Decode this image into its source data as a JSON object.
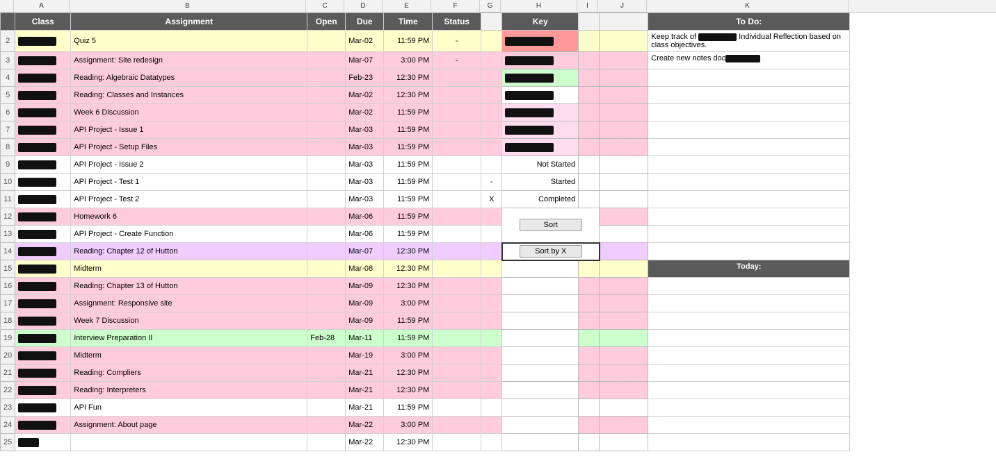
{
  "header": {
    "col_labels": [
      "",
      "A",
      "B",
      "C",
      "D",
      "E",
      "F",
      "G",
      "H",
      "I",
      "J",
      "K"
    ],
    "row1": {
      "class": "Class",
      "assignment": "Assignment",
      "open": "Open",
      "due": "Due",
      "time": "Time",
      "status": "Status",
      "key": "Key",
      "todo": "To Do:"
    }
  },
  "rows": [
    {
      "num": 2,
      "class": "",
      "assignment": "Quiz 5",
      "open": "",
      "due": "Mar-02",
      "time": "11:59 PM",
      "status": "-",
      "color": "yellow"
    },
    {
      "num": 3,
      "class": "",
      "assignment": "Assignment: Site redesign",
      "open": "",
      "due": "Mar-07",
      "time": "3:00 PM",
      "status": "-",
      "color": "pink"
    },
    {
      "num": 4,
      "class": "",
      "assignment": "Reading: Algebraic Datatypes",
      "open": "",
      "due": "Feb-23",
      "time": "12:30 PM",
      "status": "",
      "color": "pink"
    },
    {
      "num": 5,
      "class": "",
      "assignment": "Reading: Classes and Instances",
      "open": "",
      "due": "Mar-02",
      "time": "12:30 PM",
      "status": "",
      "color": "pink"
    },
    {
      "num": 6,
      "class": "",
      "assignment": "Week 6 Discussion",
      "open": "",
      "due": "Mar-02",
      "time": "11:59 PM",
      "status": "",
      "color": "pink"
    },
    {
      "num": 7,
      "class": "",
      "assignment": "API Project - Issue 1",
      "open": "",
      "due": "Mar-03",
      "time": "11:59 PM",
      "status": "",
      "color": "pink"
    },
    {
      "num": 8,
      "class": "",
      "assignment": "API Project - Setup Files",
      "open": "",
      "due": "Mar-03",
      "time": "11:59 PM",
      "status": "",
      "color": "pink"
    },
    {
      "num": 9,
      "class": "",
      "assignment": "API Project - Issue 2",
      "open": "",
      "due": "Mar-03",
      "time": "11:59 PM",
      "status": "",
      "color": "white"
    },
    {
      "num": 10,
      "class": "",
      "assignment": "API Project - Test 1",
      "open": "",
      "due": "Mar-03",
      "time": "11:59 PM",
      "status": "",
      "color": "white"
    },
    {
      "num": 11,
      "class": "",
      "assignment": "API Project - Test 2",
      "open": "",
      "due": "Mar-03",
      "time": "11:59 PM",
      "status": "",
      "color": "white"
    },
    {
      "num": 12,
      "class": "",
      "assignment": "Homework 6",
      "open": "",
      "due": "Mar-06",
      "time": "11:59 PM",
      "status": "",
      "color": "pink"
    },
    {
      "num": 13,
      "class": "",
      "assignment": "API Project - Create Function",
      "open": "",
      "due": "Mar-06",
      "time": "11:59 PM",
      "status": "",
      "color": "white"
    },
    {
      "num": 14,
      "class": "",
      "assignment": "Reading: Chapter 12 of Hutton",
      "open": "",
      "due": "Mar-07",
      "time": "12:30 PM",
      "status": "",
      "color": "lavender"
    },
    {
      "num": 15,
      "class": "",
      "assignment": "Midterm",
      "open": "",
      "due": "Mar-08",
      "time": "12:30 PM",
      "status": "",
      "color": "yellow"
    },
    {
      "num": 16,
      "class": "",
      "assignment": "Reading: Chapter 13 of Hutton",
      "open": "",
      "due": "Mar-09",
      "time": "12:30 PM",
      "status": "",
      "color": "pink"
    },
    {
      "num": 17,
      "class": "",
      "assignment": "Assignment: Responsive site",
      "open": "",
      "due": "Mar-09",
      "time": "3:00 PM",
      "status": "",
      "color": "pink"
    },
    {
      "num": 18,
      "class": "",
      "assignment": "Week 7 Discussion",
      "open": "",
      "due": "Mar-09",
      "time": "11:59 PM",
      "status": "",
      "color": "pink"
    },
    {
      "num": 19,
      "class": "",
      "assignment": "Interview Preparation II",
      "open": "Feb-28",
      "due": "Mar-11",
      "time": "11:59 PM",
      "status": "",
      "color": "green"
    },
    {
      "num": 20,
      "class": "",
      "assignment": "Midterm",
      "open": "",
      "due": "Mar-19",
      "time": "3:00 PM",
      "status": "",
      "color": "pink"
    },
    {
      "num": 21,
      "class": "",
      "assignment": "Reading: Compliers",
      "open": "",
      "due": "Mar-21",
      "time": "12:30 PM",
      "status": "",
      "color": "pink"
    },
    {
      "num": 22,
      "class": "",
      "assignment": "Reading: Interpreters",
      "open": "",
      "due": "Mar-21",
      "time": "12:30 PM",
      "status": "",
      "color": "pink"
    },
    {
      "num": 23,
      "class": "",
      "assignment": "API Fun",
      "open": "",
      "due": "Mar-21",
      "time": "11:59 PM",
      "status": "",
      "color": "white"
    },
    {
      "num": 24,
      "class": "",
      "assignment": "Assignment: About page",
      "open": "",
      "due": "Mar-22",
      "time": "3:00 PM",
      "status": "",
      "color": "pink"
    },
    {
      "num": 25,
      "class": "",
      "assignment": "",
      "open": "",
      "due": "Mar-22",
      "time": "12:30 PM",
      "status": "",
      "color": "white"
    }
  ],
  "key": {
    "title": "Key",
    "items": [
      {
        "symbol": "",
        "label": "Not Started"
      },
      {
        "symbol": "-",
        "label": "Started"
      },
      {
        "symbol": "X",
        "label": "Completed"
      }
    ],
    "buttons": {
      "sort": "Sort",
      "sort_by_x": "Sort by X"
    }
  },
  "todo": {
    "title": "To Do:",
    "items": [
      "Keep track of       Individual Reflection based on class objectives.",
      "Create new notes doc"
    ]
  },
  "today": {
    "title": "Today:"
  },
  "key_colors": {
    "row2": "#ffcccc",
    "row3": "#ffcccc",
    "row4": "#ccffcc",
    "row5": "#ffffff",
    "row6": "#ffddee",
    "row7": "#ffddee",
    "row8": "#ffddee"
  }
}
